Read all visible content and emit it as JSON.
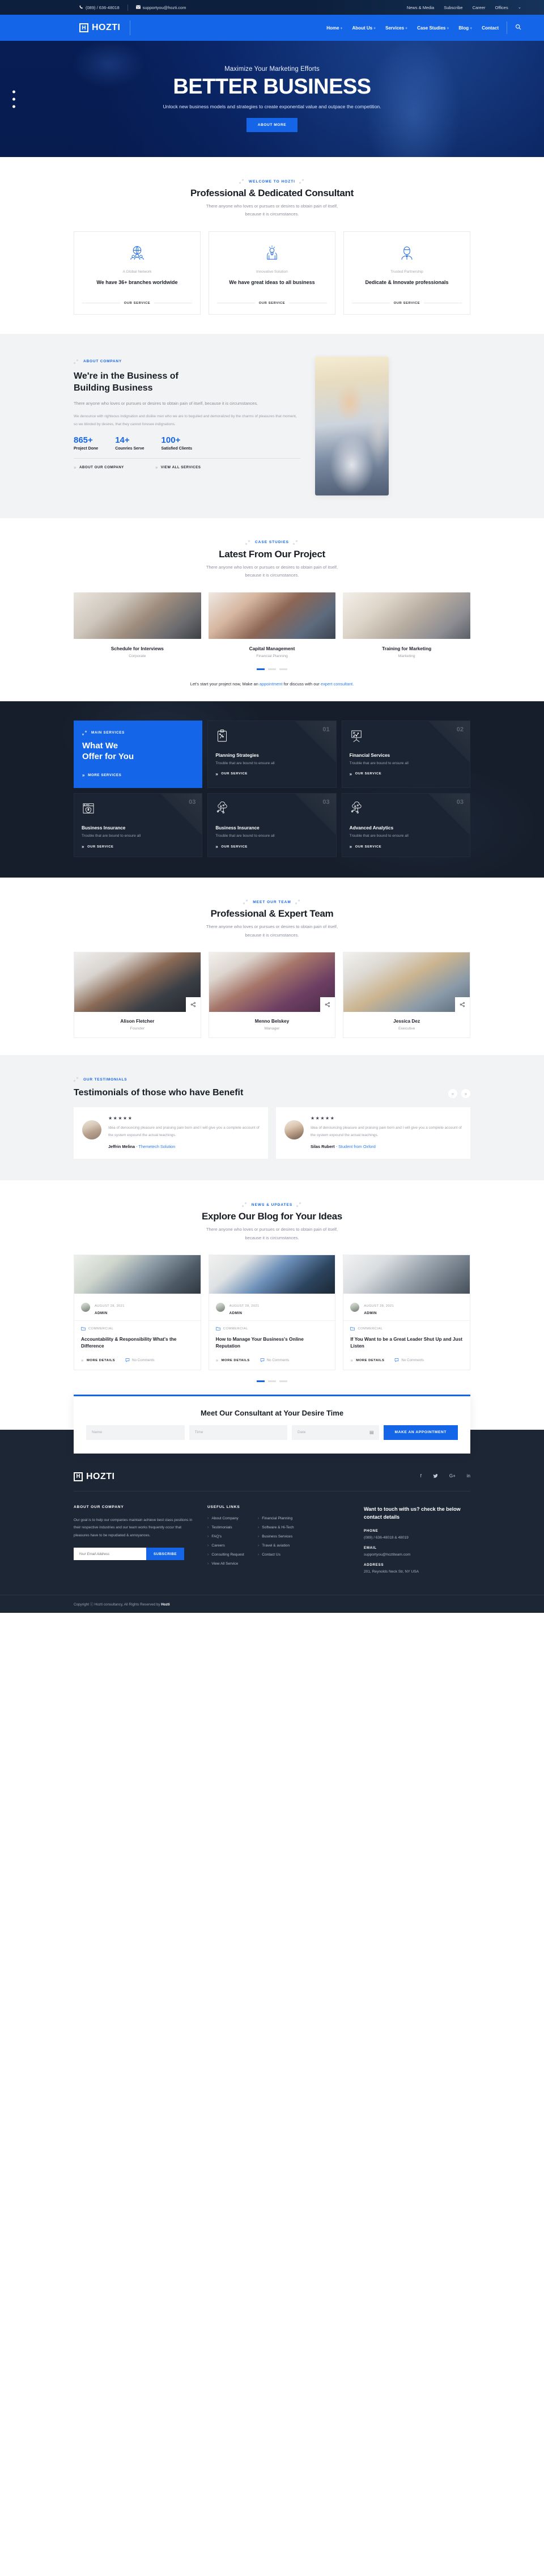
{
  "topbar": {
    "phone": "(089) / 636-48018",
    "email": "supportyou@hozti.com",
    "links": [
      "News & Media",
      "Subscribe",
      "Career",
      "Offices"
    ],
    "offices_caret": "⌄"
  },
  "nav": {
    "brand_mark": "H",
    "brand_name": "HOZTI",
    "items": [
      {
        "label": "Home",
        "has_sub": true
      },
      {
        "label": "About Us",
        "has_sub": true
      },
      {
        "label": "Services",
        "has_sub": true
      },
      {
        "label": "Case Studies",
        "has_sub": true
      },
      {
        "label": "Blog",
        "has_sub": true
      },
      {
        "label": "Contact",
        "has_sub": false
      }
    ],
    "search_icon": "⌕"
  },
  "hero": {
    "subtitle": "Maximize Your Marketing Efforts",
    "title": "BETTER BUSINESS",
    "text": "Unlock new business models and strategies to create exponential value and outpace the competition.",
    "button": "ABOUT MORE"
  },
  "welcome": {
    "eyebrow": "WELCOME TO HOZTI",
    "title": "Professional & Dedicated Consultant",
    "desc_line1": "There anyone who loves or pursues or desires to obtain pain of itself,",
    "desc_line2": "because it is circumstances.",
    "cards": [
      {
        "icon": "globe-people-icon",
        "kicker": "A Global Network",
        "title": "We have 36+ branches worldwide",
        "cta": "OUR SERVICE"
      },
      {
        "icon": "idea-hands-icon",
        "kicker": "Innovative Solution",
        "title": "We have great ideas to all business",
        "cta": "OUR SERVICE"
      },
      {
        "icon": "person-tie-icon",
        "kicker": "Trusted Partnership",
        "title": "Dedicate & Innovate professionals",
        "cta": "OUR SERVICE"
      }
    ]
  },
  "about": {
    "eyebrow": "ABOUT COMPANY",
    "title_line1": "We're in the Business of",
    "title_line2": "Building Business",
    "lead": "There anyone who loves or pursues or desires to obtain pain of itself, because it is circumstances.",
    "body": "We denounce with righteous indignation and dislike men who we are to beguiled and demoralized by the charms of pleasures that moment, so we blinded by desires, that they cannot foresee indignations.",
    "stats": [
      {
        "num": "865+",
        "label": "Project Done"
      },
      {
        "num": "14+",
        "label": "Counries Serve"
      },
      {
        "num": "100+",
        "label": "Satisfied Clients"
      }
    ],
    "links": [
      "ABOUT OUR COMPANY",
      "VIEW ALL SERVICES"
    ]
  },
  "cases": {
    "eyebrow": "CASE STUDIES",
    "title": "Latest From Our Project",
    "desc_line1": "There anyone who loves or pursues or desires to obtain pain of itself,",
    "desc_line2": "because it is circumstances.",
    "items": [
      {
        "title": "Schedule for Interviews",
        "category": "Corporate"
      },
      {
        "title": "Capital Management",
        "category": "Financial Planning"
      },
      {
        "title": "Training for Marketing",
        "category": "Marketing"
      }
    ],
    "cta_prefix": "Let's start your project now, Make an ",
    "cta_link1": "appointment",
    "cta_mid": " for discuss with our ",
    "cta_link2": "expert consultant."
  },
  "services": {
    "eyebrow": "MAIN SERVICES",
    "title_line1": "What We",
    "title_line2": "Offer for You",
    "more_link": "MORE SERVICES",
    "cards": [
      {
        "num": "01",
        "icon": "clipboard-strategy-icon",
        "title": "Planning Strategies",
        "desc": "Trouble that are bound to ensure all",
        "link": "OUR SERVICE"
      },
      {
        "num": "02",
        "icon": "presentation-chart-icon",
        "title": "Financial Services",
        "desc": "Trouble that are bound to ensure all",
        "link": "OUR SERVICE"
      },
      {
        "num": "03",
        "icon": "shield-dollar-window-icon",
        "title": "Business Insurance",
        "desc": "Trouble that are bound to ensure all",
        "link": "OUR SERVICE"
      },
      {
        "num": "03",
        "icon": "cloud-network-icon",
        "title": "Business Insurance",
        "desc": "Trouble that are bound to ensure all",
        "link": "OUR SERVICE"
      },
      {
        "num": "03",
        "icon": "cloud-network-icon",
        "title": "Advanced Analytics",
        "desc": "Trouble that are bound to ensure all",
        "link": "OUR SERVICE"
      }
    ]
  },
  "team": {
    "eyebrow": "MEET OUR TEAM",
    "title": "Professional & Expert Team",
    "desc_line1": "There anyone who loves or pursues or desires to obtain pain of itself,",
    "desc_line2": "because it is circumstances.",
    "members": [
      {
        "name": "Alison Fletcher",
        "role": "Founder"
      },
      {
        "name": "Menno Belskey",
        "role": "Manager"
      },
      {
        "name": "Jessica Dez",
        "role": "Executive"
      }
    ]
  },
  "testimonials": {
    "eyebrow": "OUR TESTIMONIALS",
    "title": "Testimonials of those who have Benefit",
    "prev": "«",
    "next": "»",
    "items": [
      {
        "stars": "★★★★★",
        "text": "Idea of denouncing pleasure and praising pain born and I will give you a complete account of the system expound the actual teachings.",
        "name": "Jeffrin Melina",
        "company": "- Themetech Solution"
      },
      {
        "stars": "★★★★★",
        "text": "Idea of denouncing pleasure and praising pain born and I will give you a complete account of the system expound the actual teachings.",
        "name": "Silas Rubert",
        "company": "- Student from Oxford"
      }
    ]
  },
  "blog": {
    "eyebrow": "NEWS & UPDATES",
    "title": "Explore Our Blog for Your Ideas",
    "desc_line1": "There anyone who loves or pursues or desires to obtain pain of itself,",
    "desc_line2": "because it is circumstances.",
    "posts": [
      {
        "date": "AUGUST 28, 2021",
        "author": "ADMIN",
        "category": "COMMERCIAL",
        "title": "Accountability & Responsibility What's the Difference",
        "more": "MORE DETAILS",
        "comments": "No Comments"
      },
      {
        "date": "AUGUST 28, 2021",
        "author": "ADMIN",
        "category": "COMMERCIAL",
        "title": "How to Manage Your Business's Online Reputation",
        "more": "MORE DETAILS",
        "comments": "No Comments"
      },
      {
        "date": "AUGUST 28, 2021",
        "author": "ADMIN",
        "category": "COMMERCIAL",
        "title": "If You Want to be a Great Leader Shut Up and Just Listen",
        "more": "MORE DETAILS",
        "comments": "No Comments"
      }
    ]
  },
  "appointment": {
    "title": "Meet Our Consultant at Your Desire Time",
    "name_placeholder": "Name",
    "time_placeholder": "Time",
    "date_placeholder": "Date",
    "calendar_icon": "▤",
    "button": "MAKE AN APPOINTMENT"
  },
  "footer": {
    "brand_mark": "H",
    "brand_name": "HOZTI",
    "socials": [
      "f",
      "🐦",
      "G+",
      "in"
    ],
    "about_heading": "ABOUT OUR COMPANY",
    "about_text": "Our goal is to help our companies maintain achieve best class positions in their respective industries and our team works frequently occur that pleasures have to be repudiated & annoyances.",
    "email_placeholder": "Your Email Address",
    "subscribe_button": "SUBSCRIBE",
    "links_heading": "USEFUL LINKS",
    "links_col1": [
      "About Company",
      "Testimonials",
      "FAQ's",
      "Careers",
      "Consulting Request",
      "View All Service"
    ],
    "links_col2": [
      "Financial Planning",
      "Software & Hi-Tech",
      "Business Services",
      "Travel & aviation",
      "Contact Us"
    ],
    "contact_heading": "Want to touch with us? check the below contact details",
    "phone_label": "PHONE",
    "phone_value": "(089) / 636-48018 & 48019",
    "email_label": "EMAIL",
    "email_value": "supportyou@hoztiteam.com",
    "address_label": "ADDRESS",
    "address_value": "201, Reynolds Neck Str, NY USA",
    "copyright_pre": "Copyright ⓒ Hozti consultancy, All Rights Reserved by ",
    "copyright_brand": "Hozti"
  },
  "colors": {
    "brand_blue": "#1565e8",
    "dark_navy": "#1d2635",
    "services_dark": "#161e2b",
    "topbar": "#0d2240"
  }
}
